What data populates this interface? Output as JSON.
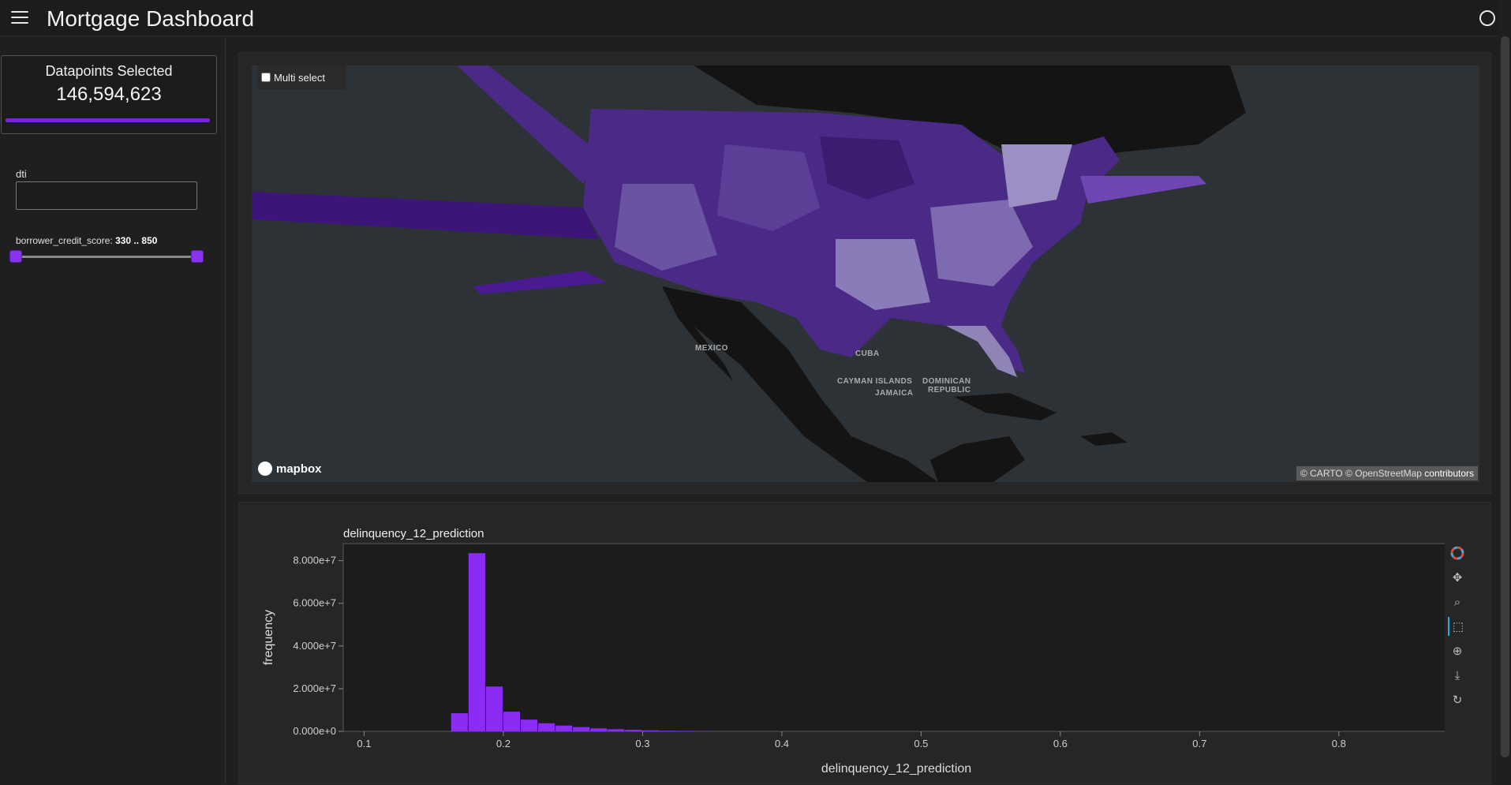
{
  "app": {
    "title": "Mortgage Dashboard"
  },
  "header": {
    "menu_icon": "hamburger-icon",
    "status_icon": "circle-icon"
  },
  "sidebar": {
    "indicator": {
      "title": "Datapoints Selected",
      "value": "146,594,623",
      "bar_fraction": 1.0
    },
    "dti": {
      "label": "dti",
      "value": ""
    },
    "credit_score": {
      "label": "borrower_credit_score:",
      "range_text": "330 .. 850",
      "min": 330,
      "max": 850,
      "low": 330,
      "high": 850
    }
  },
  "map": {
    "multi_select_label": "Multi select",
    "labels": {
      "mexico": "MEXICO",
      "cuba": "CUBA",
      "cayman": "CAYMAN ISLANDS",
      "jamaica": "JAMAICA",
      "dominican": "DOMINICAN",
      "republic": "REPUBLIC"
    },
    "logo": "mapbox",
    "attribution": {
      "carto": "© CARTO",
      "osm": "© OpenStreetMap",
      "contrib": "contributors"
    }
  },
  "chart_data": {
    "type": "bar",
    "title": "delinquency_12_prediction",
    "xlabel": "delinquency_12_prediction",
    "ylabel": "frequency",
    "xlim": [
      0.085,
      0.88
    ],
    "ylim": [
      0,
      88000000
    ],
    "xticks": [
      "0.1",
      "0.2",
      "0.3",
      "0.4",
      "0.5",
      "0.6",
      "0.7",
      "0.8"
    ],
    "yticks": [
      "0.000e+0",
      "2.000e+7",
      "4.000e+7",
      "6.000e+7",
      "8.000e+7"
    ],
    "bin_width": 0.0125,
    "bins": [
      0.1625,
      0.175,
      0.1875,
      0.2,
      0.2125,
      0.225,
      0.2375,
      0.25,
      0.2625,
      0.275,
      0.2875,
      0.3,
      0.3125,
      0.325,
      0.3375
    ],
    "values": [
      8500000,
      83500000,
      21000000,
      9200000,
      5500000,
      3800000,
      2700000,
      2000000,
      1400000,
      1000000,
      700000,
      450000,
      300000,
      200000,
      120000
    ],
    "bar_color": "#8b2cf5",
    "grid": false
  },
  "toolbar": {
    "tools": [
      "bokeh-logo-icon",
      "pan-icon",
      "box-zoom-icon",
      "box-select-icon",
      "wheel-zoom-icon",
      "save-icon",
      "reset-icon"
    ]
  }
}
